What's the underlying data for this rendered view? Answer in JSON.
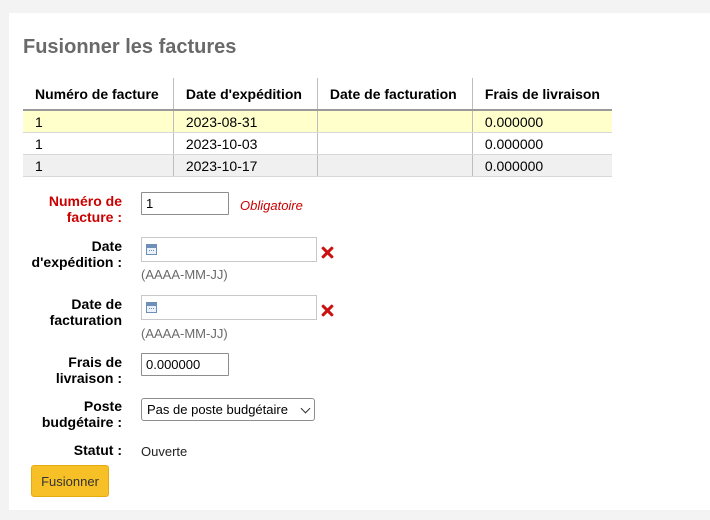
{
  "page": {
    "title": "Fusionner les factures"
  },
  "table": {
    "headers": [
      "Numéro de facture",
      "Date d'expédition",
      "Date de facturation",
      "Frais de livraison"
    ],
    "rows": [
      [
        "1",
        "2023-08-31",
        "",
        "0.000000"
      ],
      [
        "1",
        "2023-10-03",
        "",
        "0.000000"
      ],
      [
        "1",
        "2023-10-17",
        "",
        "0.000000"
      ]
    ]
  },
  "form": {
    "invoice_number": {
      "label_line1": "Numéro de",
      "label_line2": "facture :",
      "value": "1",
      "required_note": "Obligatoire"
    },
    "shipment_date": {
      "label_line1": "Date",
      "label_line2": "d'expédition :",
      "value": "",
      "hint": "(AAAA-MM-JJ)"
    },
    "billing_date": {
      "label_line1": "Date de",
      "label_line2": "facturation",
      "value": "",
      "hint": "(AAAA-MM-JJ)"
    },
    "shipping_cost": {
      "label_line1": "Frais de",
      "label_line2": "livraison :",
      "value": "0.000000"
    },
    "fund": {
      "label_line1": "Poste",
      "label_line2": "budgétaire :",
      "selected": "Pas de poste budgétaire"
    },
    "status": {
      "label": "Statut :",
      "value": "Ouverte"
    }
  },
  "actions": {
    "merge_label": "Fusionner"
  },
  "colors": {
    "title": "#696969",
    "required": "#cc0000",
    "row_highlight": "#ffffcc",
    "button": "#f6c026",
    "clear_icon": "#cc1111"
  },
  "icons": [
    "calendar-icon",
    "clear-icon",
    "chevron-down-icon"
  ]
}
